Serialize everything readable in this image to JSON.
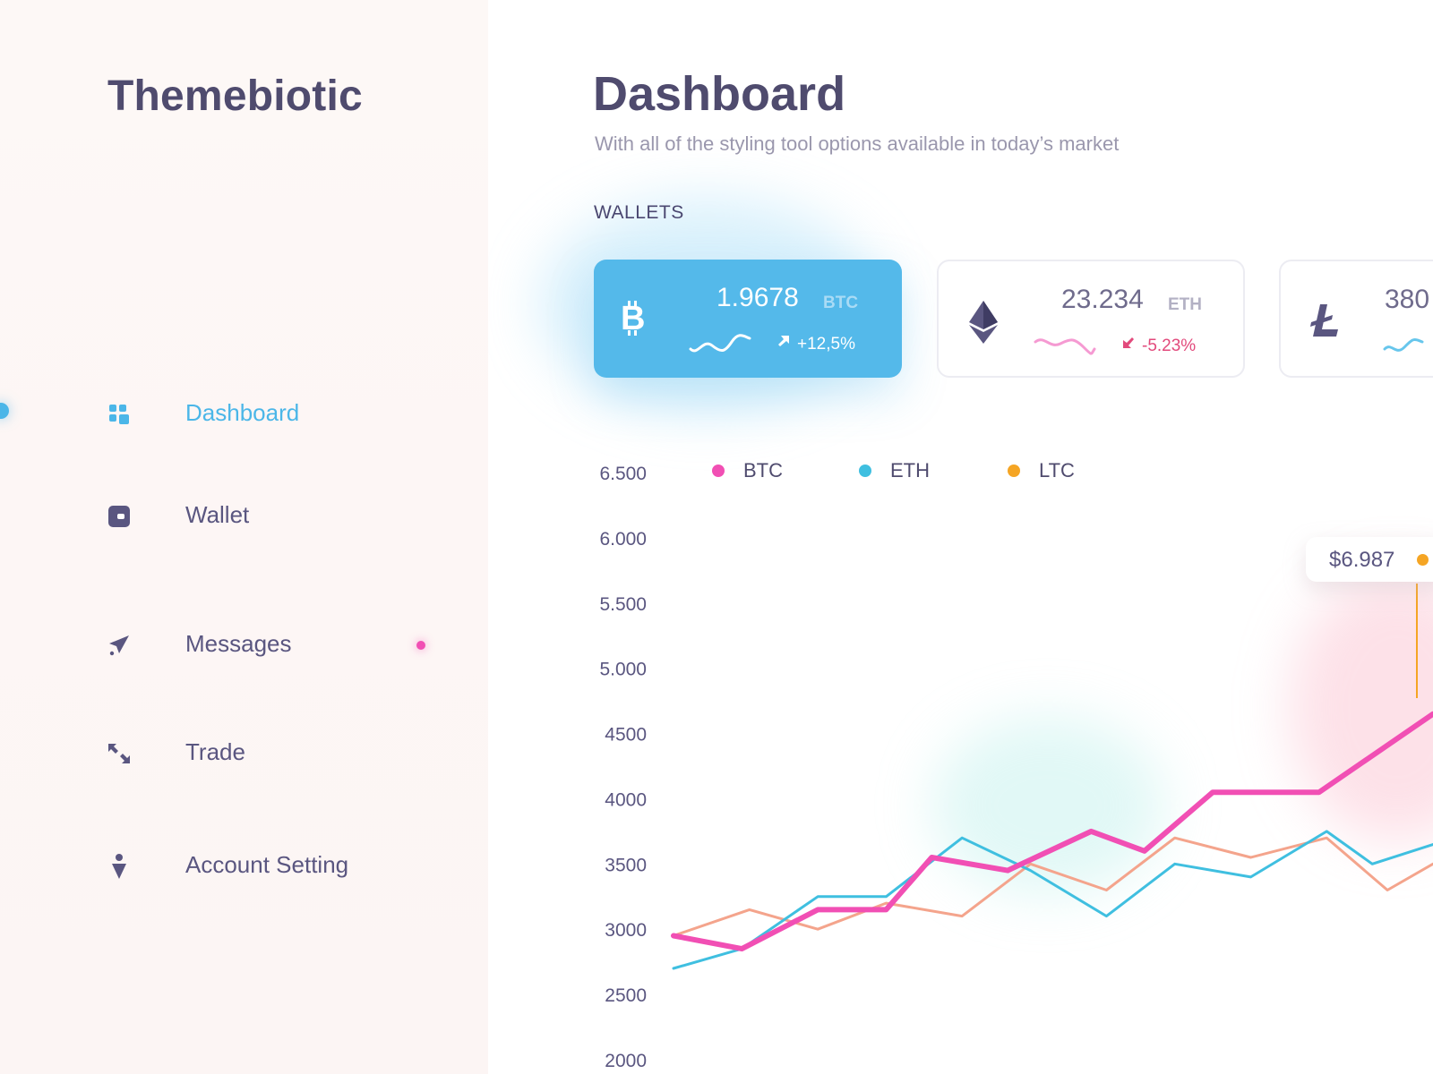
{
  "app": {
    "brand": "Themebiotic"
  },
  "sidebar": {
    "items": [
      {
        "label": "Dashboard",
        "icon": "dashboard-icon",
        "active": true
      },
      {
        "label": "Wallet",
        "icon": "wallet-icon",
        "active": false
      },
      {
        "label": "Messages",
        "icon": "paper-plane-icon",
        "active": false,
        "badge": "unread-dot"
      },
      {
        "label": "Trade",
        "icon": "trade-arrows-icon",
        "active": false
      },
      {
        "label": "Account Setting",
        "icon": "user-pin-icon",
        "active": false
      }
    ]
  },
  "header": {
    "title": "Dashboard",
    "subtitle": "With all of the styling tool options available in today’s market"
  },
  "wallets": {
    "label": "WALLETS",
    "cards": [
      {
        "coin": "btc",
        "icon": "bitcoin-icon",
        "amount": "1.9678",
        "unit": "BTC",
        "change": "+12,5%",
        "trend": "up"
      },
      {
        "coin": "eth",
        "icon": "ethereum-icon",
        "amount": "23.234",
        "unit": "ETH",
        "change": "-5.23%",
        "trend": "down"
      },
      {
        "coin": "ltc",
        "icon": "litecoin-icon",
        "amount": "380",
        "unit": "",
        "change": "",
        "trend": ""
      }
    ]
  },
  "tooltip": {
    "value": "$6.987"
  },
  "colors": {
    "accent": "#4bb6e8",
    "btc": "#f14fb4",
    "eth": "#3fbfe0",
    "ltc": "#f5a524",
    "ltc_line": "#f4a48c",
    "text": "#4f4b6e"
  },
  "chart_data": {
    "type": "line",
    "y_ticks": [
      "6.500",
      "6.000",
      "5.500",
      "5.000",
      "4500",
      "4000",
      "3500",
      "3000",
      "2500",
      "2000"
    ],
    "ylim": [
      2000,
      6500
    ],
    "xlim": [
      0,
      100
    ],
    "grid": false,
    "legend_position": "top",
    "series": [
      {
        "name": "BTC",
        "color": "#f14fb4",
        "x": [
          0,
          9,
          19,
          28,
          34,
          44,
          55,
          62,
          71,
          75,
          85,
          100
        ],
        "y": [
          2950,
          2850,
          3150,
          3150,
          3550,
          3450,
          3750,
          3600,
          4050,
          4050,
          4050,
          4650
        ]
      },
      {
        "name": "ETH",
        "color": "#3fbfe0",
        "x": [
          0,
          9,
          19,
          28,
          38,
          47,
          57,
          66,
          76,
          86,
          92,
          100
        ],
        "y": [
          2700,
          2850,
          3250,
          3250,
          3700,
          3450,
          3100,
          3500,
          3400,
          3750,
          3500,
          3650
        ]
      },
      {
        "name": "LTC",
        "color": "#f4a48c",
        "x": [
          0,
          10,
          19,
          28,
          38,
          47,
          57,
          66,
          76,
          86,
          94,
          100
        ],
        "y": [
          2950,
          3150,
          3000,
          3200,
          3100,
          3500,
          3300,
          3700,
          3550,
          3700,
          3300,
          3500
        ]
      }
    ]
  }
}
